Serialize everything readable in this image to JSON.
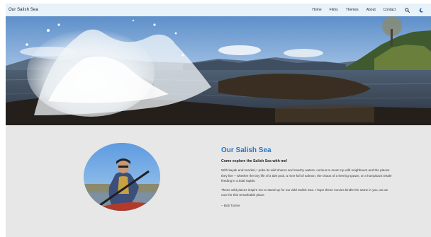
{
  "header": {
    "site_title": "Our Salish Sea",
    "nav": [
      "Home",
      "Films",
      "Themes",
      "About",
      "Contact"
    ]
  },
  "icons": {
    "search": "search-icon",
    "theme_toggle": "moon-icon"
  },
  "main": {
    "heading": "Our Salish Sea",
    "subheading": "Come explore the Salish Sea with me!",
    "paragraph1": "With kayak and snorkel, I poke its wild shores and nearby waters, curious to meet my wild neighbours and the places they live – whether the tiny life of a tide pool, a river full of salmon, the chaos of a herring spawn, or a humpback whale feeding in a tidal rapids.",
    "paragraph2": "These wild places inspire me to stand up for our wild Salish Sea. I hope these movies kindle the same in you, as we care for this remarkable place.",
    "signature": "– Bob Turner"
  },
  "colors": {
    "header_bg": "#e8f2f9",
    "content_bg": "#e7e7e7",
    "heading_accent": "#2478c4"
  }
}
